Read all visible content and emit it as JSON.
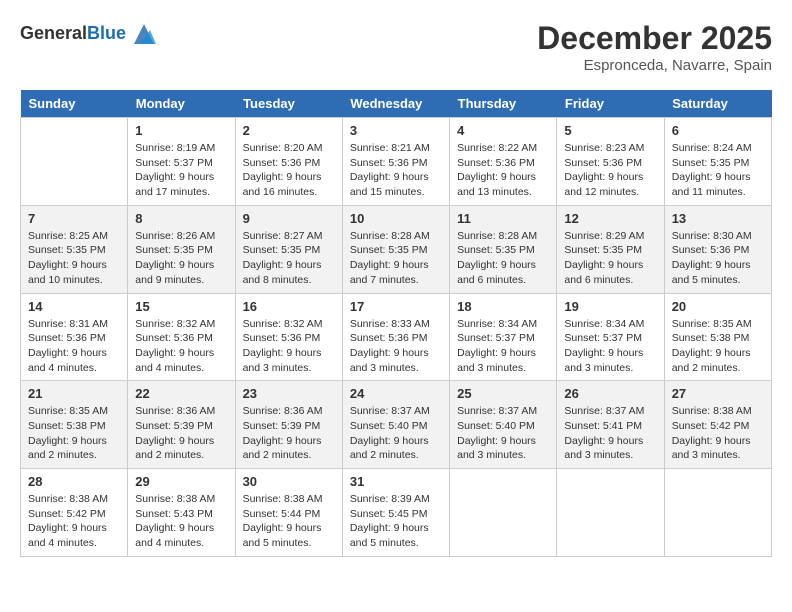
{
  "header": {
    "logo_general": "General",
    "logo_blue": "Blue",
    "month_title": "December 2025",
    "location": "Espronceda, Navarre, Spain"
  },
  "days_of_week": [
    "Sunday",
    "Monday",
    "Tuesday",
    "Wednesday",
    "Thursday",
    "Friday",
    "Saturday"
  ],
  "weeks": [
    [
      {
        "day": "",
        "sunrise": "",
        "sunset": "",
        "daylight": ""
      },
      {
        "day": "1",
        "sunrise": "Sunrise: 8:19 AM",
        "sunset": "Sunset: 5:37 PM",
        "daylight": "Daylight: 9 hours and 17 minutes."
      },
      {
        "day": "2",
        "sunrise": "Sunrise: 8:20 AM",
        "sunset": "Sunset: 5:36 PM",
        "daylight": "Daylight: 9 hours and 16 minutes."
      },
      {
        "day": "3",
        "sunrise": "Sunrise: 8:21 AM",
        "sunset": "Sunset: 5:36 PM",
        "daylight": "Daylight: 9 hours and 15 minutes."
      },
      {
        "day": "4",
        "sunrise": "Sunrise: 8:22 AM",
        "sunset": "Sunset: 5:36 PM",
        "daylight": "Daylight: 9 hours and 13 minutes."
      },
      {
        "day": "5",
        "sunrise": "Sunrise: 8:23 AM",
        "sunset": "Sunset: 5:36 PM",
        "daylight": "Daylight: 9 hours and 12 minutes."
      },
      {
        "day": "6",
        "sunrise": "Sunrise: 8:24 AM",
        "sunset": "Sunset: 5:35 PM",
        "daylight": "Daylight: 9 hours and 11 minutes."
      }
    ],
    [
      {
        "day": "7",
        "sunrise": "Sunrise: 8:25 AM",
        "sunset": "Sunset: 5:35 PM",
        "daylight": "Daylight: 9 hours and 10 minutes."
      },
      {
        "day": "8",
        "sunrise": "Sunrise: 8:26 AM",
        "sunset": "Sunset: 5:35 PM",
        "daylight": "Daylight: 9 hours and 9 minutes."
      },
      {
        "day": "9",
        "sunrise": "Sunrise: 8:27 AM",
        "sunset": "Sunset: 5:35 PM",
        "daylight": "Daylight: 9 hours and 8 minutes."
      },
      {
        "day": "10",
        "sunrise": "Sunrise: 8:28 AM",
        "sunset": "Sunset: 5:35 PM",
        "daylight": "Daylight: 9 hours and 7 minutes."
      },
      {
        "day": "11",
        "sunrise": "Sunrise: 8:28 AM",
        "sunset": "Sunset: 5:35 PM",
        "daylight": "Daylight: 9 hours and 6 minutes."
      },
      {
        "day": "12",
        "sunrise": "Sunrise: 8:29 AM",
        "sunset": "Sunset: 5:35 PM",
        "daylight": "Daylight: 9 hours and 6 minutes."
      },
      {
        "day": "13",
        "sunrise": "Sunrise: 8:30 AM",
        "sunset": "Sunset: 5:36 PM",
        "daylight": "Daylight: 9 hours and 5 minutes."
      }
    ],
    [
      {
        "day": "14",
        "sunrise": "Sunrise: 8:31 AM",
        "sunset": "Sunset: 5:36 PM",
        "daylight": "Daylight: 9 hours and 4 minutes."
      },
      {
        "day": "15",
        "sunrise": "Sunrise: 8:32 AM",
        "sunset": "Sunset: 5:36 PM",
        "daylight": "Daylight: 9 hours and 4 minutes."
      },
      {
        "day": "16",
        "sunrise": "Sunrise: 8:32 AM",
        "sunset": "Sunset: 5:36 PM",
        "daylight": "Daylight: 9 hours and 3 minutes."
      },
      {
        "day": "17",
        "sunrise": "Sunrise: 8:33 AM",
        "sunset": "Sunset: 5:36 PM",
        "daylight": "Daylight: 9 hours and 3 minutes."
      },
      {
        "day": "18",
        "sunrise": "Sunrise: 8:34 AM",
        "sunset": "Sunset: 5:37 PM",
        "daylight": "Daylight: 9 hours and 3 minutes."
      },
      {
        "day": "19",
        "sunrise": "Sunrise: 8:34 AM",
        "sunset": "Sunset: 5:37 PM",
        "daylight": "Daylight: 9 hours and 3 minutes."
      },
      {
        "day": "20",
        "sunrise": "Sunrise: 8:35 AM",
        "sunset": "Sunset: 5:38 PM",
        "daylight": "Daylight: 9 hours and 2 minutes."
      }
    ],
    [
      {
        "day": "21",
        "sunrise": "Sunrise: 8:35 AM",
        "sunset": "Sunset: 5:38 PM",
        "daylight": "Daylight: 9 hours and 2 minutes."
      },
      {
        "day": "22",
        "sunrise": "Sunrise: 8:36 AM",
        "sunset": "Sunset: 5:39 PM",
        "daylight": "Daylight: 9 hours and 2 minutes."
      },
      {
        "day": "23",
        "sunrise": "Sunrise: 8:36 AM",
        "sunset": "Sunset: 5:39 PM",
        "daylight": "Daylight: 9 hours and 2 minutes."
      },
      {
        "day": "24",
        "sunrise": "Sunrise: 8:37 AM",
        "sunset": "Sunset: 5:40 PM",
        "daylight": "Daylight: 9 hours and 2 minutes."
      },
      {
        "day": "25",
        "sunrise": "Sunrise: 8:37 AM",
        "sunset": "Sunset: 5:40 PM",
        "daylight": "Daylight: 9 hours and 3 minutes."
      },
      {
        "day": "26",
        "sunrise": "Sunrise: 8:37 AM",
        "sunset": "Sunset: 5:41 PM",
        "daylight": "Daylight: 9 hours and 3 minutes."
      },
      {
        "day": "27",
        "sunrise": "Sunrise: 8:38 AM",
        "sunset": "Sunset: 5:42 PM",
        "daylight": "Daylight: 9 hours and 3 minutes."
      }
    ],
    [
      {
        "day": "28",
        "sunrise": "Sunrise: 8:38 AM",
        "sunset": "Sunset: 5:42 PM",
        "daylight": "Daylight: 9 hours and 4 minutes."
      },
      {
        "day": "29",
        "sunrise": "Sunrise: 8:38 AM",
        "sunset": "Sunset: 5:43 PM",
        "daylight": "Daylight: 9 hours and 4 minutes."
      },
      {
        "day": "30",
        "sunrise": "Sunrise: 8:38 AM",
        "sunset": "Sunset: 5:44 PM",
        "daylight": "Daylight: 9 hours and 5 minutes."
      },
      {
        "day": "31",
        "sunrise": "Sunrise: 8:39 AM",
        "sunset": "Sunset: 5:45 PM",
        "daylight": "Daylight: 9 hours and 5 minutes."
      },
      {
        "day": "",
        "sunrise": "",
        "sunset": "",
        "daylight": ""
      },
      {
        "day": "",
        "sunrise": "",
        "sunset": "",
        "daylight": ""
      },
      {
        "day": "",
        "sunrise": "",
        "sunset": "",
        "daylight": ""
      }
    ]
  ]
}
